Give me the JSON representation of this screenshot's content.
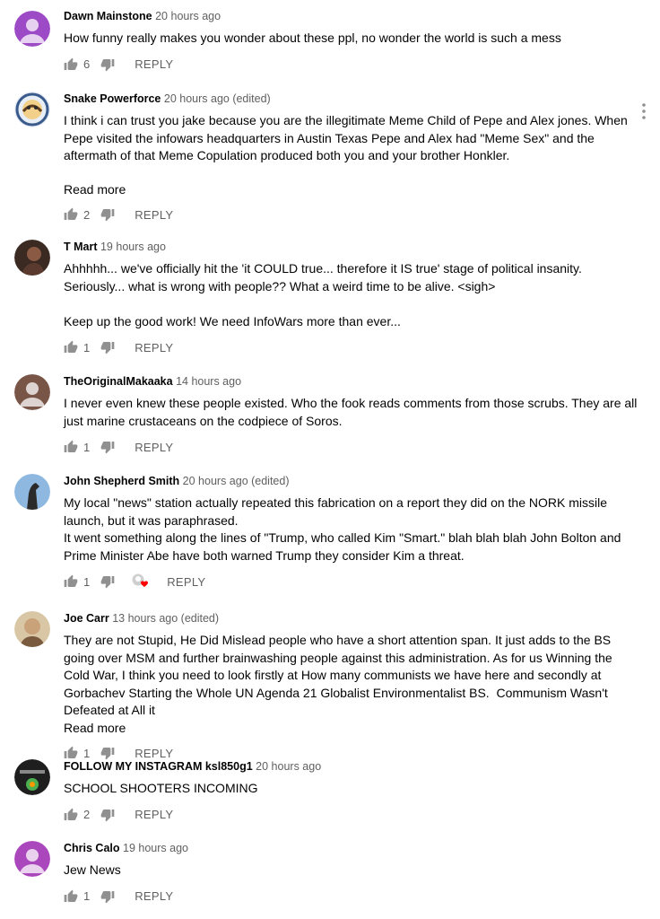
{
  "comments": [
    {
      "author": "Dawn Mainstone",
      "meta": "20 hours ago",
      "text": "How funny really makes you wonder about these ppl, no wonder the world is such a mess",
      "likes": "6",
      "reply": "REPLY",
      "avatar_color": "#9c4ac6"
    },
    {
      "author": "Snake Powerforce",
      "meta": "20 hours ago (edited)",
      "text": "I think i can trust you jake because you are the illegitimate Meme Child of Pepe and Alex jones. When Pepe visited the infowars headquarters in Austin Texas Pepe and Alex had \"Meme Sex\" and the aftermath of that Meme Copulation produced both you and your brother Honkler.",
      "read_more": "Read more",
      "likes": "2",
      "reply": "REPLY"
    },
    {
      "author": "T Mart",
      "meta": "19 hours ago",
      "text": "Ahhhhh... we've officially hit the 'it COULD true... therefore it IS true' stage of political insanity. Seriously... what is wrong with people?? What a weird time to be alive. <sigh>\n\nKeep up the good work! We need InfoWars more than ever...",
      "likes": "1",
      "reply": "REPLY"
    },
    {
      "author": "TheOriginalMakaaka",
      "meta": "14 hours ago",
      "text": "I never even knew these people existed. Who the fook reads comments from those scrubs. They are all just marine crustaceans on the codpiece of Soros.",
      "likes": "1",
      "reply": "REPLY",
      "avatar_color": "#795548"
    },
    {
      "author": "John Shepherd Smith",
      "meta": "20 hours ago (edited)",
      "text": "My local \"news\" station actually repeated this fabrication on a report they did on the NORK missile launch, but it was paraphrased.\nIt went something along the lines of \"Trump, who called Kim \"Smart.\" blah blah blah John Bolton and Prime Minister Abe have both warned Trump they consider Kim a threat.",
      "likes": "1",
      "reply": "REPLY"
    },
    {
      "author": "Joe Carr",
      "meta": "13 hours ago (edited)",
      "text": "They are not Stupid, He Did Mislead people who have a short attention span. It just adds to the BS going over MSM and further brainwashing people against this administration. As for us Winning the Cold War, I think you need to look firstly at How many communists we have here and secondly at Gorbachev Starting the Whole UN Agenda 21 Globalist Environmentalist BS.  Communism Wasn't Defeated at All it",
      "read_more": "Read more",
      "likes": "1",
      "reply": "REPLY"
    },
    {
      "author": "FOLLOW MY INSTAGRAM ksl850g1",
      "meta": "20 hours ago",
      "text": "SCHOOL SHOOTERS INCOMING",
      "likes": "2",
      "reply": "REPLY"
    },
    {
      "author": "Chris Calo",
      "meta": "19 hours ago",
      "text": "Jew News",
      "likes": "1",
      "reply": "REPLY",
      "avatar_color": "#ab47bc"
    }
  ]
}
